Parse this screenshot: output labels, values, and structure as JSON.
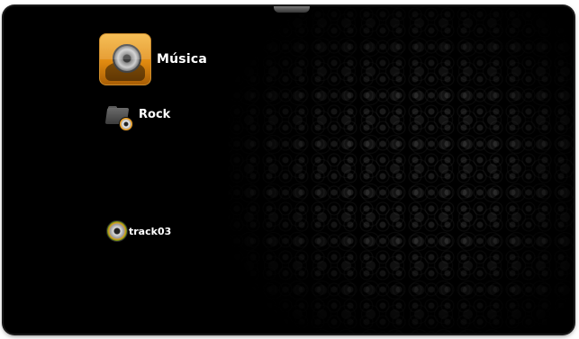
{
  "menu": {
    "category": {
      "label": "Música",
      "icon": "music-disc-icon"
    },
    "folder": {
      "label": "Rock",
      "icon": "folder-music-icon"
    },
    "track": {
      "label": "track03",
      "icon": "audio-track-icon"
    }
  },
  "colors": {
    "background": "#000000",
    "accent": "#e08a10",
    "text": "#ffffff"
  }
}
